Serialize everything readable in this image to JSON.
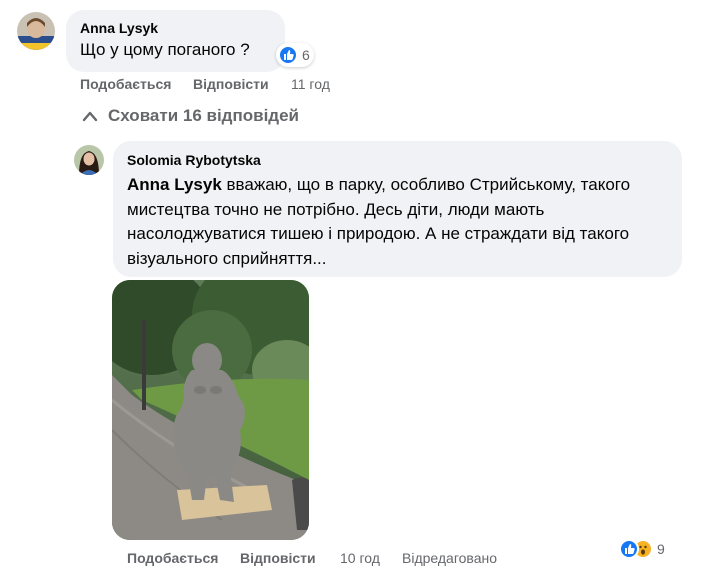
{
  "comment": {
    "author": "Anna Lysyk",
    "text": "Що у цому поганого ?",
    "reaction_count": "6",
    "actions": {
      "like": "Подобається",
      "reply": "Відповісти",
      "time": "11 год"
    }
  },
  "replies_toggle": {
    "label": "Сховати 16 відповідей",
    "icon": "chevron-up-icon"
  },
  "reply": {
    "author": "Solomia Rybotytska",
    "mention": "Anna Lysyk",
    "text": " вважаю, що в парку, особливо Стрийському, такого мистецтва точно не потрібно. Десь діти, люди мають насолоджуватися тишею і природою. А не страждати від такого візуального сприйняття...",
    "reaction_count": "9",
    "actions": {
      "like": "Подобається",
      "reply": "Відповісти",
      "time": "10 год",
      "edited": "Відредаговано"
    }
  },
  "colors": {
    "bubble": "#f0f2f5",
    "meta": "#65676b",
    "like_blue": "#1877f2",
    "wow_yellow": "#f7b125"
  }
}
